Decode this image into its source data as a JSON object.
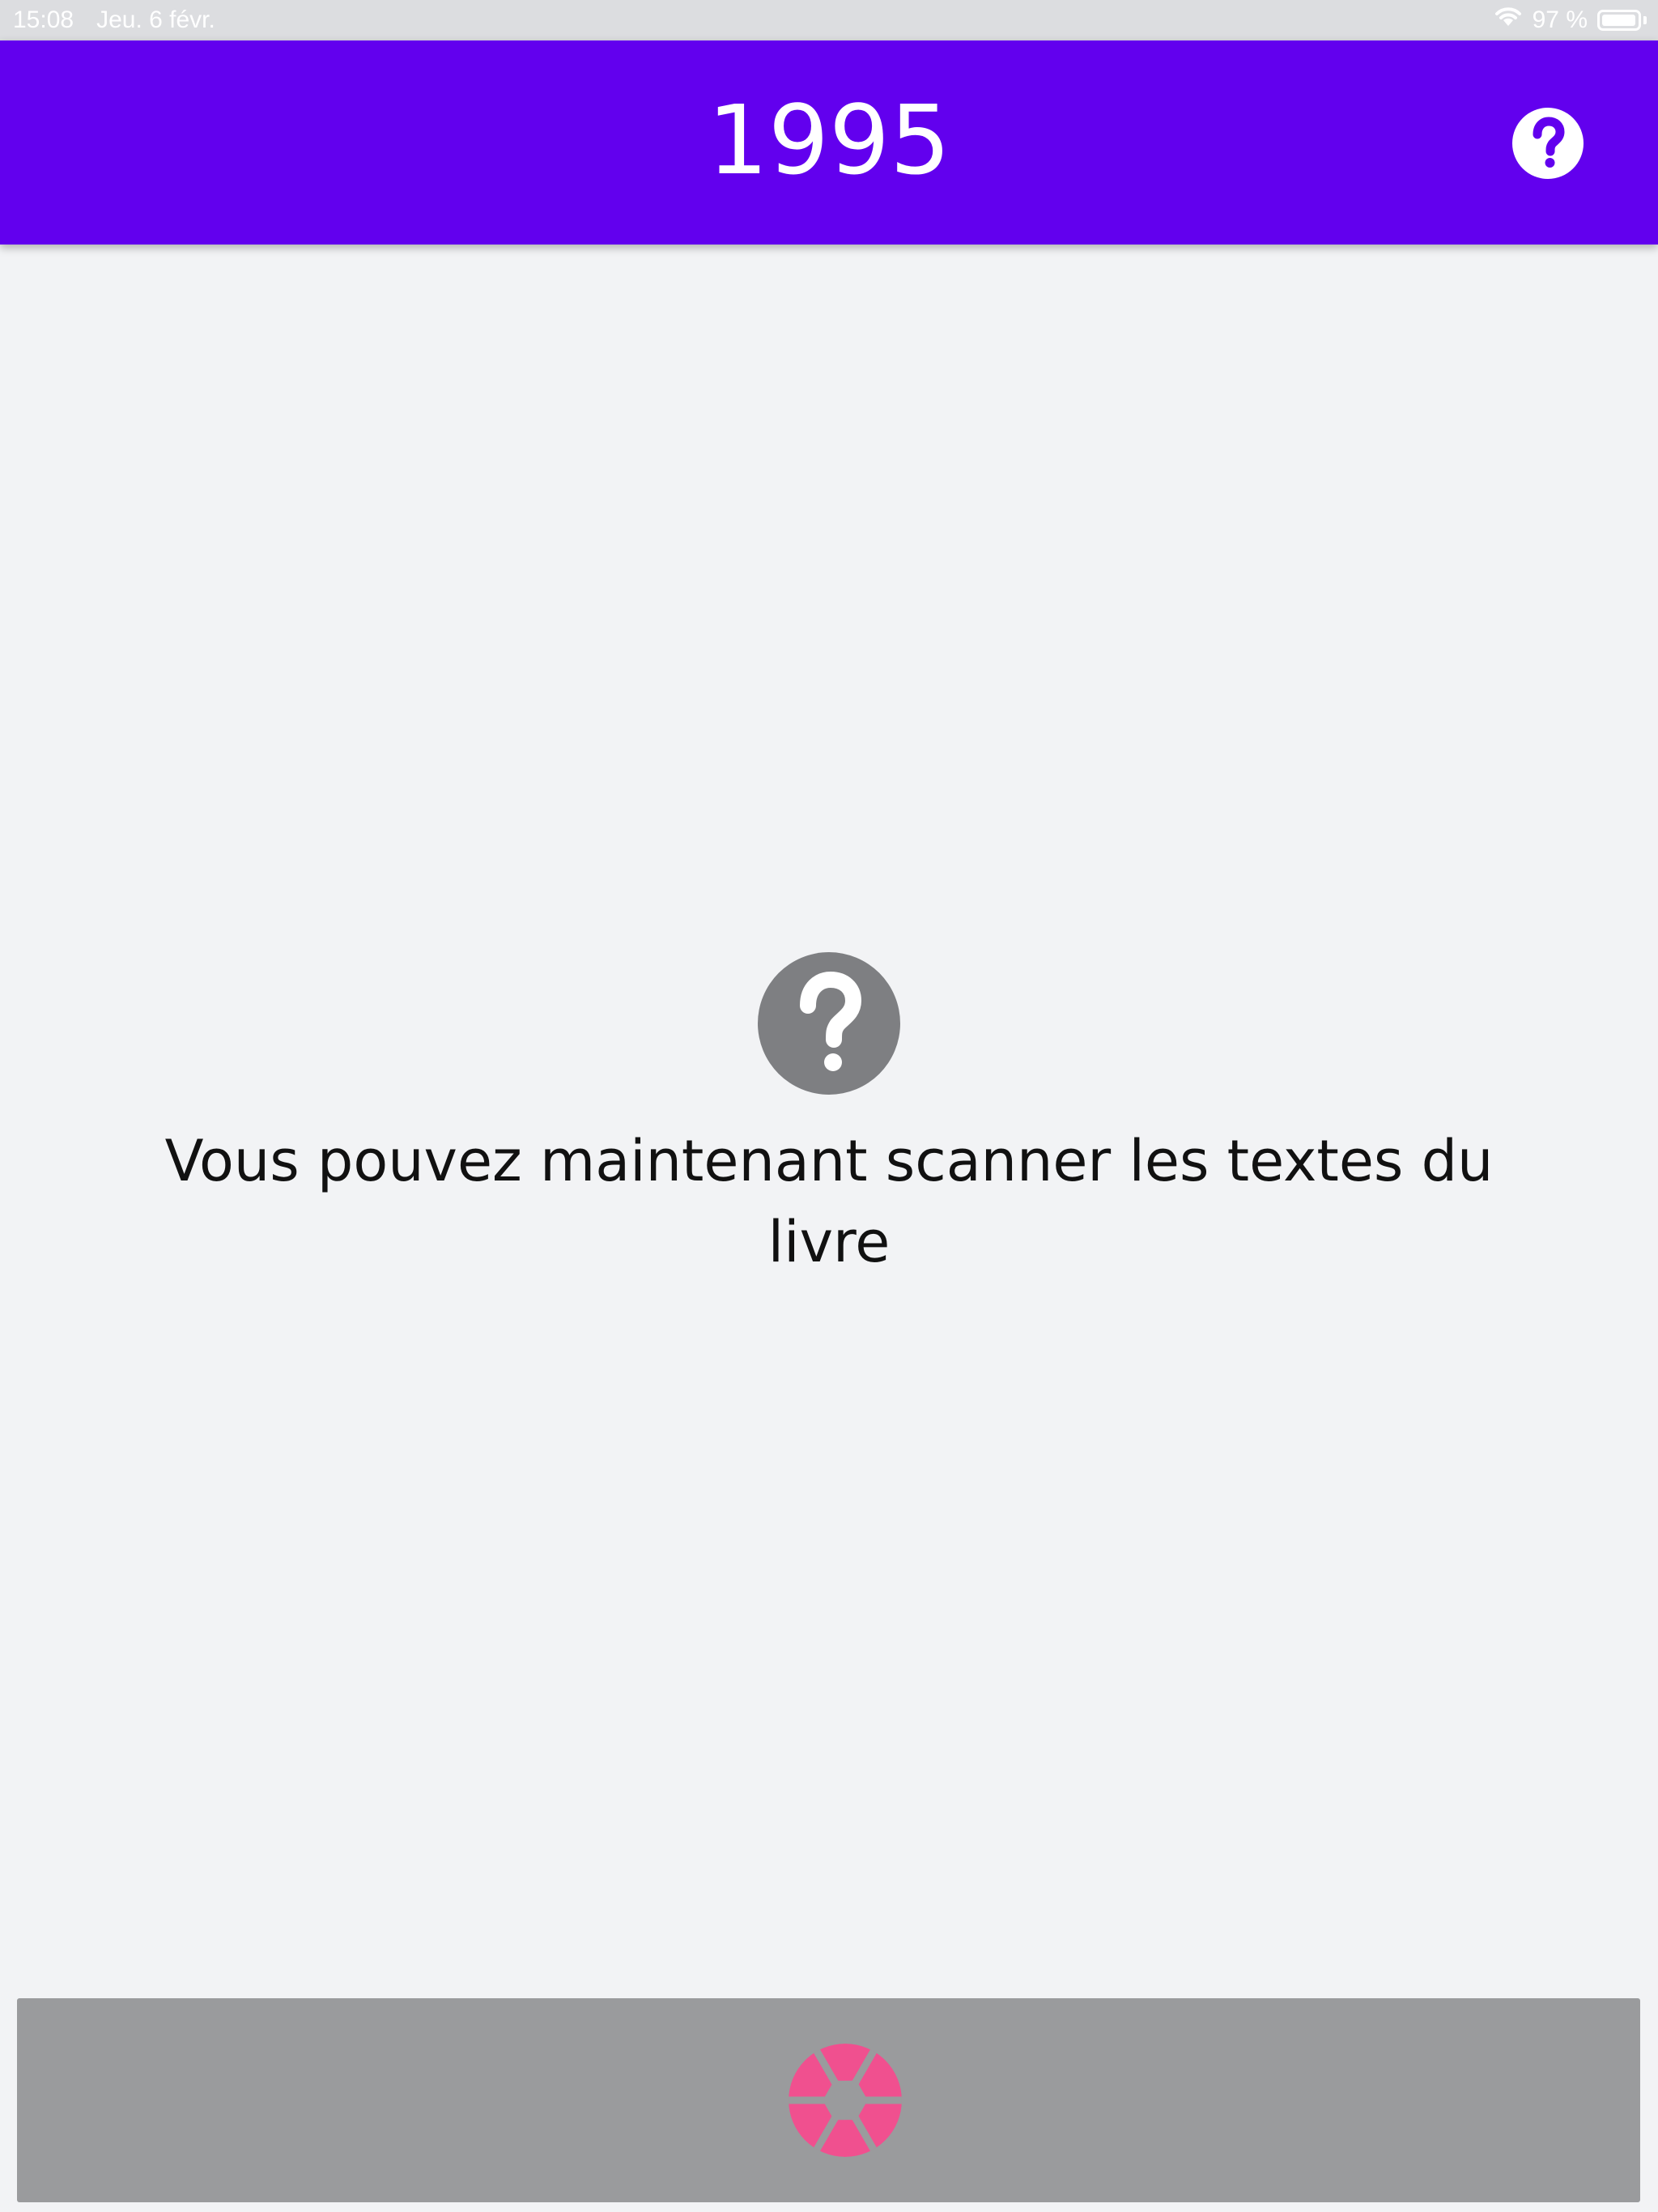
{
  "status_bar": {
    "time": "15:08",
    "date": "Jeu. 6 févr.",
    "battery": "97 %",
    "battery_level": 0.97,
    "icons": [
      "wifi-icon",
      "battery-icon"
    ]
  },
  "header": {
    "title": "1995",
    "help_icon": "help-circle-icon",
    "background_color": "#6200ee"
  },
  "empty_state": {
    "icon": "help-circle-icon",
    "message": "Vous pouvez maintenant scanner les textes du livre"
  },
  "scan_bar": {
    "icon": "camera-shutter-icon",
    "icon_color": "#f0508f"
  }
}
